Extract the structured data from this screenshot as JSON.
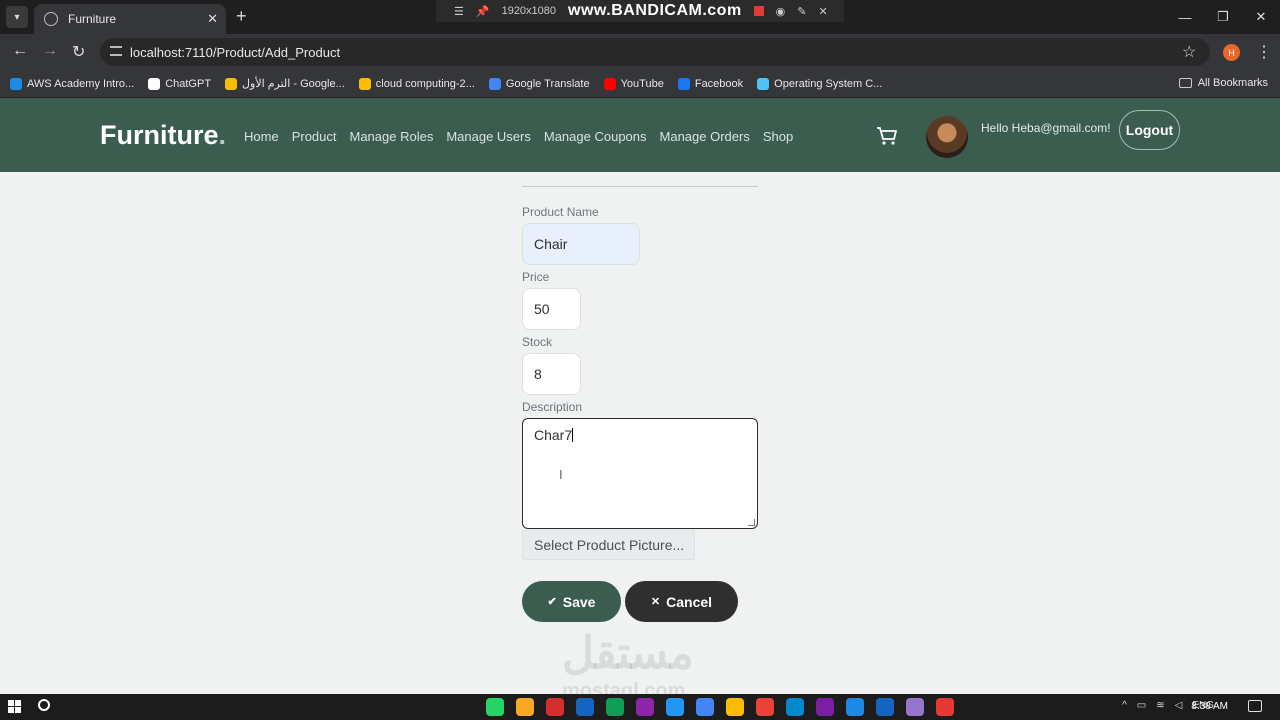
{
  "browser": {
    "tab_title": "Furniture",
    "url": "localhost:7110/Product/Add_Product",
    "profile_initial": "H",
    "recorder": {
      "resolution": "1920x1080",
      "brand": "www.BANDICAM.com"
    },
    "bookmarks": [
      {
        "label": "AWS Academy Intro...",
        "color": "#1e88e5"
      },
      {
        "label": "ChatGPT",
        "color": "#ffffff"
      },
      {
        "label": "الترم الأول - Google...",
        "color": "#fbbc04"
      },
      {
        "label": "cloud computing-2...",
        "color": "#fbbc04"
      },
      {
        "label": "Google Translate",
        "color": "#4285f4"
      },
      {
        "label": "YouTube",
        "color": "#ff0000"
      },
      {
        "label": "Facebook",
        "color": "#1877f2"
      },
      {
        "label": "Operating System C...",
        "color": "#4fc3f7"
      }
    ],
    "all_bookmarks": "All Bookmarks"
  },
  "site": {
    "brand": "Furniture",
    "brand_dot": ".",
    "nav": [
      "Home",
      "Product",
      "Manage Roles",
      "Manage Users",
      "Manage Coupons",
      "Manage Orders",
      "Shop"
    ],
    "greeting": "Hello Heba@gmail.com!",
    "logout_label": "Logout",
    "accent_color": "#3b5d50"
  },
  "form": {
    "name_label": "Product Name",
    "name_value": "Chair",
    "price_label": "Price",
    "price_value": "50",
    "stock_label": "Stock",
    "stock_value": "8",
    "description_label": "Description",
    "description_value": "Char7",
    "picture_button": "Select Product Picture...",
    "save_label": "Save",
    "cancel_label": "Cancel"
  },
  "watermark": {
    "arabic": "مستقل",
    "latin": "mostaql.com"
  },
  "taskbar": {
    "language": "ENG",
    "time": "8:38 AM",
    "app_colors": [
      "#25d366",
      "#f9a825",
      "#d32f2f",
      "#1565c0",
      "#0f9d58",
      "#8e24aa",
      "#2196f3",
      "#4285f4",
      "#fbbc04",
      "#ea4335",
      "#0088cc",
      "#7b1fa2",
      "#1e88e5",
      "#1565c0",
      "#9575cd",
      "#e53935"
    ]
  }
}
